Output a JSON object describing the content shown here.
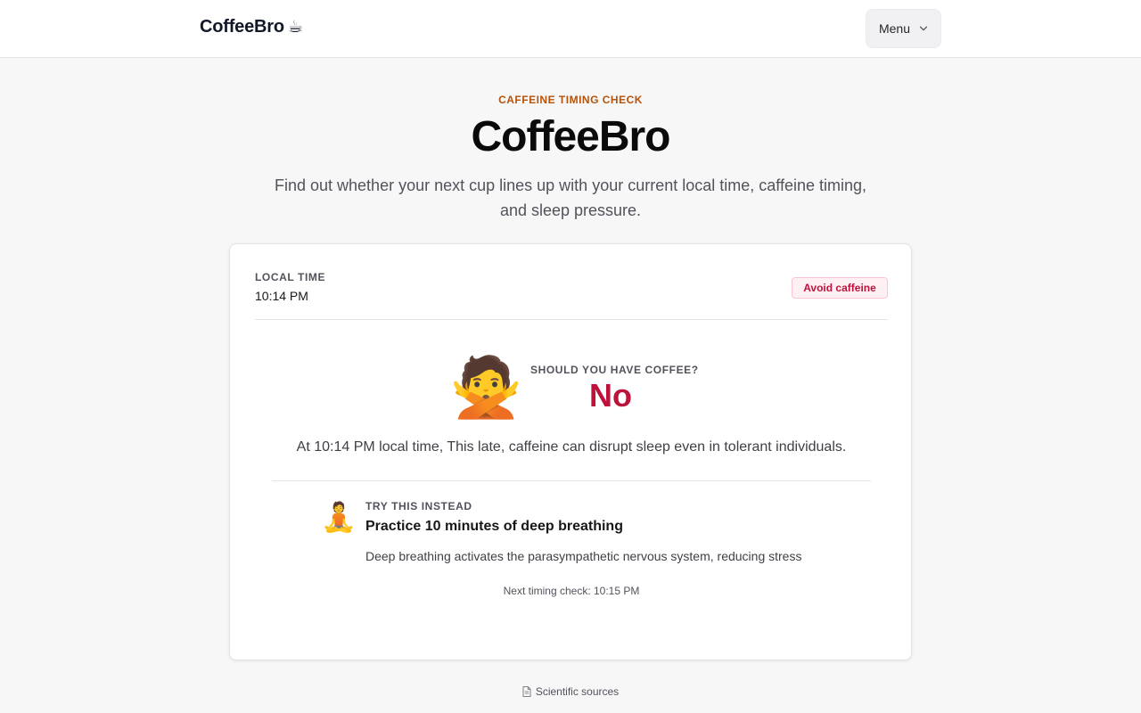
{
  "header": {
    "brand": "CoffeeBro",
    "brand_icon": "☕",
    "menu_label": "Menu"
  },
  "hero": {
    "eyebrow": "CAFFEINE TIMING CHECK",
    "title": "CoffeeBro",
    "subtitle": "Find out whether your next cup lines up with your current local time, caffeine timing, and sleep pressure."
  },
  "card": {
    "local_time_label": "LOCAL TIME",
    "local_time_value": "10:14 PM",
    "badge": "Avoid caffeine",
    "verdict_emoji": "🙅",
    "question_label": "SHOULD YOU HAVE COFFEE?",
    "answer": "No",
    "reason": "At 10:14 PM local time, This late, caffeine can disrupt sleep even in tolerant individuals.",
    "alternative": {
      "emoji": "🧘",
      "label": "TRY THIS INSTEAD",
      "title": "Practice 10 minutes of deep breathing",
      "description": "Deep breathing activates the parasympathetic nervous system, reducing stress"
    },
    "next_check": "Next timing check: 10:15 PM"
  },
  "footer": {
    "sources_label": "Scientific sources",
    "sources_icon": "document-icon"
  },
  "colors": {
    "accent_eyebrow": "#b45309",
    "danger": "#be123c",
    "badge_bg": "#fef0f3",
    "page_bg": "#f7f7f8"
  }
}
